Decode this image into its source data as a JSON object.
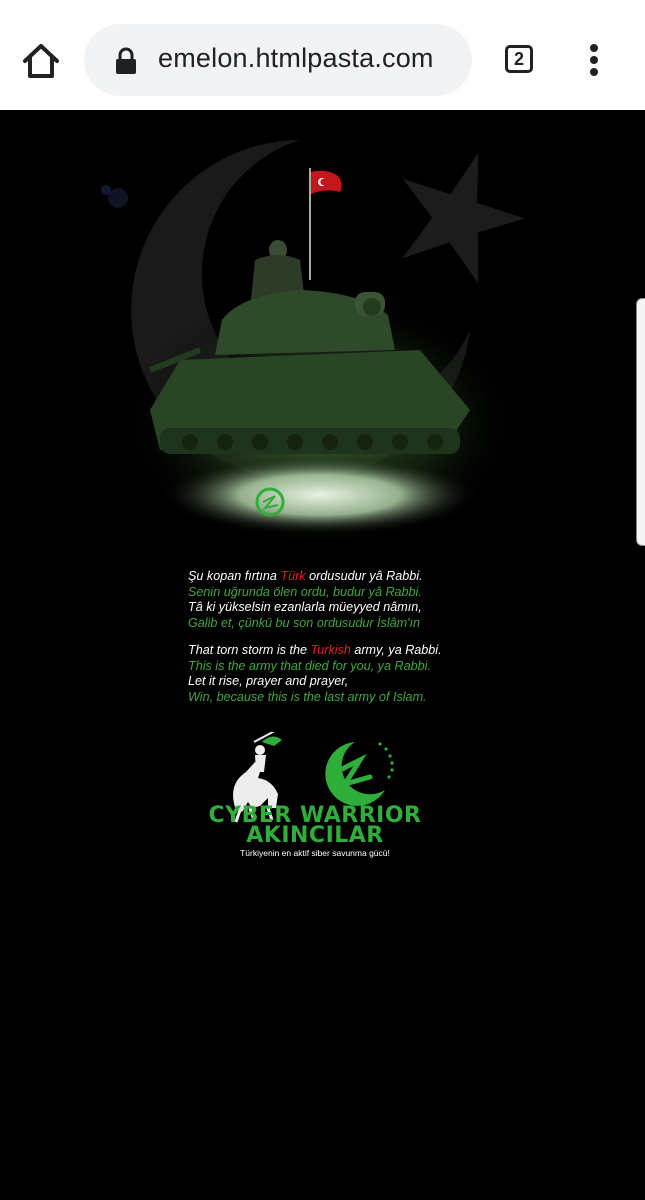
{
  "browser": {
    "url": "emelon.htmlpasta.com",
    "tab_count": "2",
    "home_icon": "home-icon",
    "lock_icon": "lock-icon",
    "menu_icon": "more-vert-icon"
  },
  "poem": {
    "tr": [
      {
        "parts": [
          {
            "t": "Şu kopan fırtına ",
            "c": "w"
          },
          {
            "t": "Türk",
            "c": "r"
          },
          {
            "t": " ordusudur yâ Rabbi.",
            "c": "w"
          }
        ]
      },
      {
        "parts": [
          {
            "t": "Senin uğrunda ölen ordu, budur yâ Rabbi.",
            "c": "g"
          }
        ]
      },
      {
        "parts": [
          {
            "t": "Tâ ki yükselsin ezanlarla müeyyed nâmın,",
            "c": "w"
          }
        ]
      },
      {
        "parts": [
          {
            "t": "Galib et, çünkü bu son ordusudur İslâm'ın",
            "c": "g"
          }
        ]
      }
    ],
    "en": [
      {
        "parts": [
          {
            "t": "That torn storm is the ",
            "c": "w"
          },
          {
            "t": "Turkish",
            "c": "r"
          },
          {
            "t": " army, ya Rabbi.",
            "c": "w"
          }
        ]
      },
      {
        "parts": [
          {
            "t": "This is the army that died for you, ya Rabbi.",
            "c": "g"
          }
        ]
      },
      {
        "parts": [
          {
            "t": "Let it rise, prayer and prayer,",
            "c": "w"
          }
        ]
      },
      {
        "parts": [
          {
            "t": "Win, because this is the last army of Islam.",
            "c": "g"
          }
        ]
      }
    ]
  },
  "logo": {
    "line1": "CYBER WARRIOR",
    "line2": "AKINCILAR",
    "tagline": "Türkiyenin en aktif siber savunma gücü!"
  },
  "colors": {
    "green": "#2fae3a",
    "red": "#e32020",
    "poem_green": "#3fa83a"
  }
}
